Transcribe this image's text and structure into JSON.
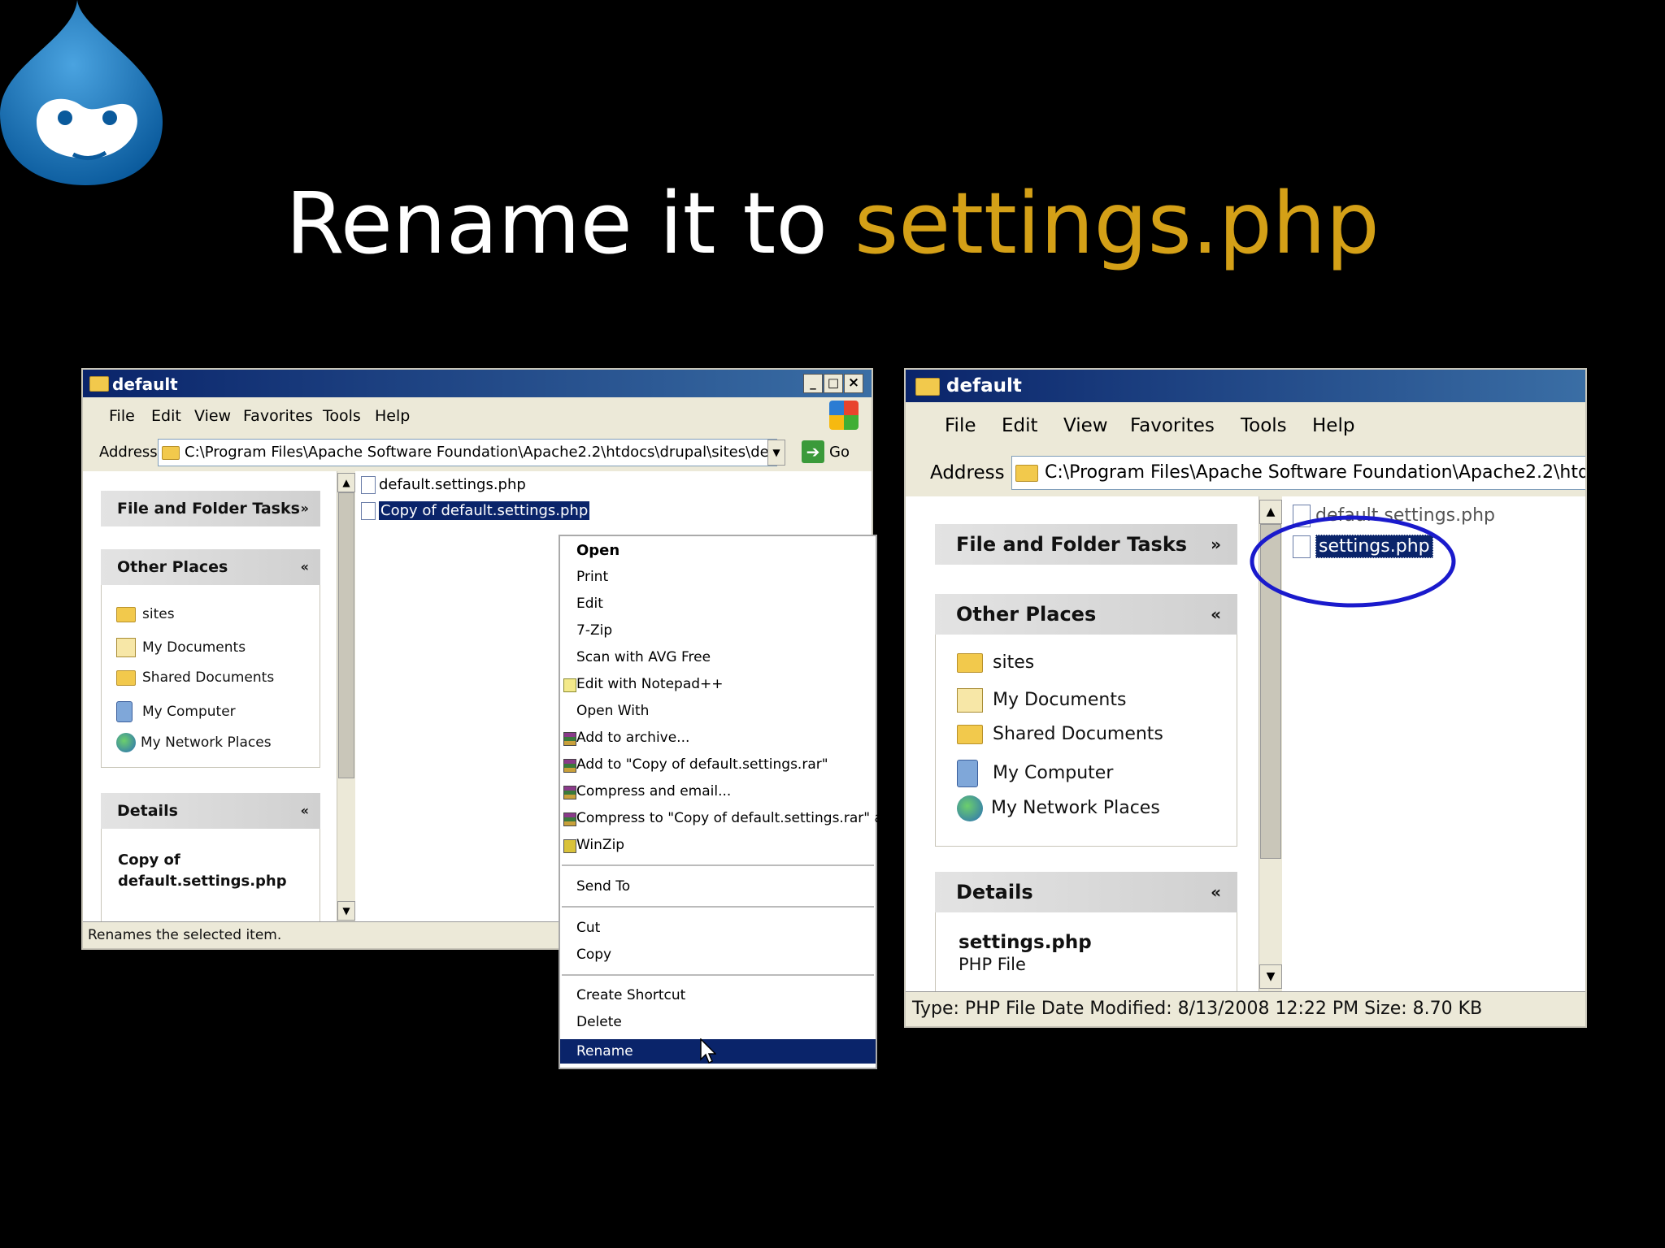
{
  "slide": {
    "title_prefix": "Rename it to ",
    "title_highlight": "settings.php",
    "highlight_color": "#d4a017",
    "logo_icon": "drupal-drop-icon"
  },
  "left_window": {
    "title": "default",
    "controls": [
      "_",
      "□",
      "×"
    ],
    "menu": [
      "File",
      "Edit",
      "View",
      "Favorites",
      "Tools",
      "Help"
    ],
    "address_label": "Address",
    "address_value": "C:\\Program Files\\Apache Software Foundation\\Apache2.2\\htdocs\\drupal\\sites\\default",
    "go_label": "Go",
    "tasks_panel": {
      "title": "File and Folder Tasks"
    },
    "other_places": {
      "title": "Other Places",
      "items": [
        "sites",
        "My Documents",
        "Shared Documents",
        "My Computer",
        "My Network Places"
      ]
    },
    "details": {
      "title": "Details",
      "line1": "Copy of",
      "line2": "default.settings.php"
    },
    "files": [
      "default.settings.php",
      "Copy of default.settings.php"
    ],
    "status": "Renames the selected item."
  },
  "context_menu": {
    "items": [
      "Open",
      "Print",
      "Edit",
      "7-Zip",
      "Scan with AVG Free",
      "Edit with Notepad++",
      "Open With",
      "Add to archive...",
      "Add to \"Copy of default.settings.rar\"",
      "Compress and email...",
      "Compress to \"Copy of default.settings.rar\" and",
      "WinZip",
      "Send To",
      "Cut",
      "Copy",
      "Create Shortcut",
      "Delete",
      "Rename"
    ],
    "active": "Rename"
  },
  "right_window": {
    "title": "default",
    "menu": [
      "File",
      "Edit",
      "View",
      "Favorites",
      "Tools",
      "Help"
    ],
    "address_label": "Address",
    "address_value": "C:\\Program Files\\Apache Software Foundation\\Apache2.2\\htd",
    "tasks_panel": {
      "title": "File and Folder Tasks"
    },
    "other_places": {
      "title": "Other Places",
      "items": [
        "sites",
        "My Documents",
        "Shared Documents",
        "My Computer",
        "My Network Places"
      ]
    },
    "details": {
      "title": "Details",
      "line1": "settings.php",
      "line2": "PHP File"
    },
    "files": [
      "default.settings.php",
      "settings.php"
    ],
    "status": "Type: PHP File Date Modified: 8/13/2008 12:22 PM Size: 8.70 KB",
    "highlight_circle_color": "#1a1acc"
  }
}
